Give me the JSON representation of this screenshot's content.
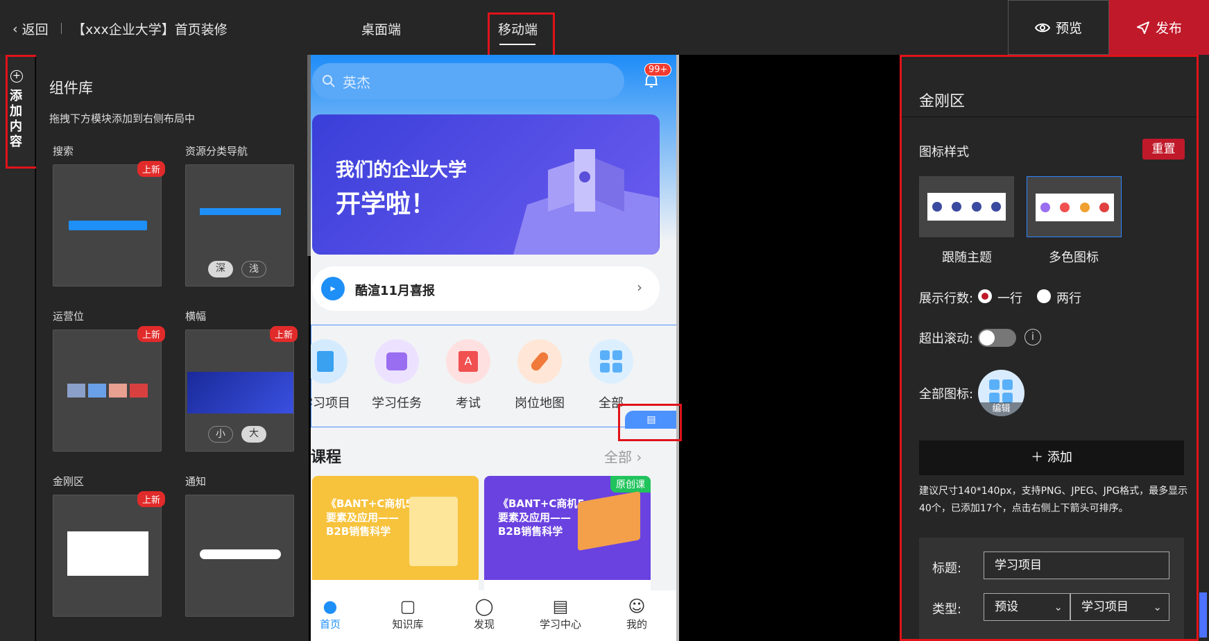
{
  "topbar": {
    "back_label": "返回",
    "page_title": "【xxx企业大学】首页装修",
    "tab_desktop": "桌面端",
    "tab_mobile": "移动端",
    "preview_label": "预览",
    "publish_label": "发布"
  },
  "rail": {
    "add_content": "添加内容"
  },
  "library": {
    "title": "组件库",
    "hint": "拖拽下方模块添加到右侧布局中",
    "new_badge": "上新",
    "components": [
      {
        "label": "搜索",
        "new": true
      },
      {
        "label": "资源分类导航",
        "new": false,
        "options": [
          "深",
          "浅"
        ]
      },
      {
        "label": "运营位",
        "new": true
      },
      {
        "label": "横幅",
        "new": true,
        "options": [
          "小",
          "大"
        ]
      },
      {
        "label": "金刚区",
        "new": true
      },
      {
        "label": "通知",
        "new": false
      }
    ]
  },
  "phone": {
    "search_placeholder": "英杰",
    "bell_badge": "99+",
    "banner_line1": "我们的企业大学",
    "banner_line2": "开学啦！",
    "notice_text": "酷渲11月喜报",
    "kingkong": [
      "学习项目",
      "学习任务",
      "考试",
      "岗位地图",
      "全部"
    ],
    "course_section_title": "课程",
    "course_all": "全部",
    "courses": [
      {
        "title": "《BANT+C商机5要素及应用——B2B销售科学",
        "badge": ""
      },
      {
        "title": "《BANT+C商机5要素及应用——B2B销售科学",
        "badge": "原创课"
      }
    ],
    "tabbar": [
      "首页",
      "知识库",
      "发现",
      "学习中心",
      "我的"
    ]
  },
  "panel": {
    "title": "金刚区",
    "icon_style_label": "图标样式",
    "reset_label": "重置",
    "styles": [
      "跟随主题",
      "多色图标"
    ],
    "rows_label": "展示行数:",
    "rows_options": [
      "一行",
      "两行"
    ],
    "rows_selected": "一行",
    "scroll_label": "超出滚动:",
    "scroll_enabled": false,
    "all_icon_label": "全部图标:",
    "edit_label": "编辑",
    "add_label": "＋ 添加",
    "add_hint": "建议尺寸140*140px，支持PNG、JPEG、JPG格式，最多显示40个，已添加17个，点击右侧上下箭头可排序。",
    "item": {
      "title_label": "标题:",
      "title_value": "学习项目",
      "type_label": "类型:",
      "type_value": "预设",
      "type_sub_value": "学习项目"
    }
  },
  "colors": {
    "accent_red": "#c0192a",
    "highlight_red": "#e0131a",
    "phone_blue": "#1e8ff7"
  }
}
